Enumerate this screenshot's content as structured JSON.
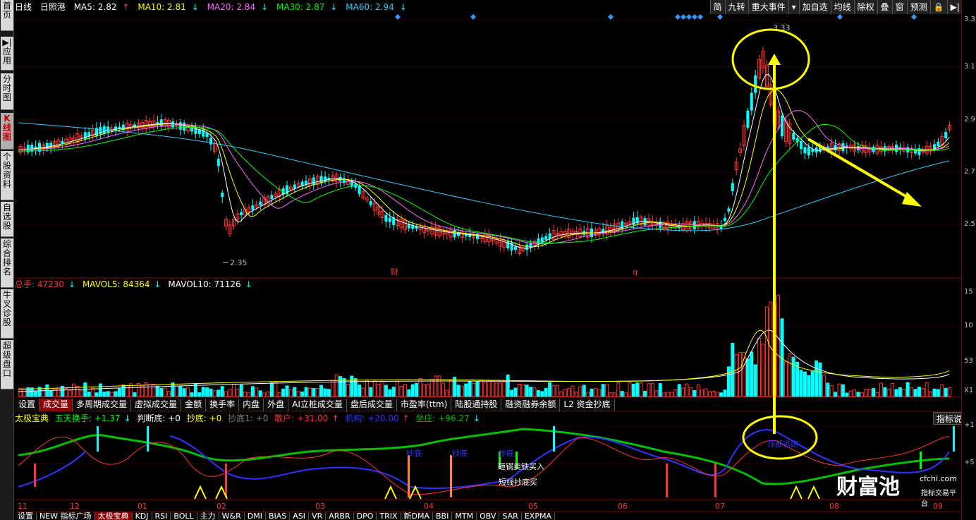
{
  "sidebar": {
    "items": [
      {
        "label": "首页"
      },
      {
        "label": "▶|应用"
      },
      {
        "label": "分时图"
      },
      {
        "label": "K线图"
      },
      {
        "label": "个股资料"
      },
      {
        "label": "自选股"
      },
      {
        "label": "综合排名"
      },
      {
        "label": "牛叉诊股"
      },
      {
        "label": "超级盘口"
      }
    ]
  },
  "header": {
    "period": "日线",
    "stock": "日照港",
    "ma5": "MA5: 2.82",
    "ma10": "MA10: 2.81",
    "ma20": "MA20: 2.84",
    "ma30": "MA30: 2.87",
    "ma60": "MA60: 2.94",
    "arrow_up": "↑",
    "arrow_down": "↓"
  },
  "toolbar": {
    "items": [
      "简",
      "九转",
      "重大事件",
      "▾",
      "加自选",
      "均线",
      "除权",
      "叠",
      "窗",
      "预测",
      "🔒",
      "▶|",
      "✕"
    ]
  },
  "price_chart": {
    "high_label": "3.33",
    "low_label": "2.35",
    "y_ticks": [
      "3.3",
      "3.1",
      "2.9",
      "2.7",
      "2.5"
    ],
    "markers": [
      "财",
      "q"
    ]
  },
  "volume": {
    "label": "总手: 47230",
    "mavol5": "MAVOL5: 84364",
    "mavol10": "MAVOL10: 71126",
    "y_ticks": [
      "15",
      "10",
      "53",
      "X1"
    ]
  },
  "tabs": [
    "设置",
    "成交量",
    "多周期成交量",
    "虚拟成交量",
    "金额",
    "换手率",
    "内盘",
    "外盘",
    "AI立桩成交量",
    "盘后成交量",
    "市盈率(ttm)",
    "陆股通持股",
    "融资融券余额",
    "L2 资金抄底"
  ],
  "indicator": {
    "name": "太极宝典",
    "turnover": "五天换手: +1.37",
    "judge": "判断底: +0",
    "chaodi": "抄底: +0",
    "chaodi1": "抄底1: +0",
    "retail": "散户: +31.00",
    "institution": "机构: +20.00",
    "zuozhuang": "坐庄: +96.27",
    "help": "指标说明",
    "y_ticks": [
      "+1",
      "+5"
    ],
    "annotations": [
      "抄底",
      "抄底",
      "抄底",
      "砸锅卖铁买入",
      "短线抄底买",
      "顶部逃跑"
    ]
  },
  "x_axis": [
    "11",
    "12",
    "01",
    "02",
    "03",
    "04",
    "05",
    "06",
    "07",
    "08",
    "09"
  ],
  "bottom_tabs": [
    "设置",
    "NEW 指标广场",
    "太极宝典",
    "KDJ",
    "RSI",
    "BOLL",
    "主力",
    "W&R",
    "DMI",
    "BIAS",
    "ASI",
    "VR",
    "ARBR",
    "DPO",
    "TRIX",
    "新DMA",
    "BBI",
    "MTM",
    "OBV",
    "SAR",
    "EXPMA"
  ],
  "watermark": {
    "main": "财富池",
    "url": "cfchi.com",
    "sub": "指标交易平台"
  },
  "colors": {
    "up": "#ff3333",
    "down": "#00ffff",
    "ma5": "#ffffff",
    "ma10": "#ffff00",
    "ma20": "#ff66ff",
    "ma30": "#00ff00",
    "ma60": "#33ccff",
    "annotation": "#ffff00"
  }
}
